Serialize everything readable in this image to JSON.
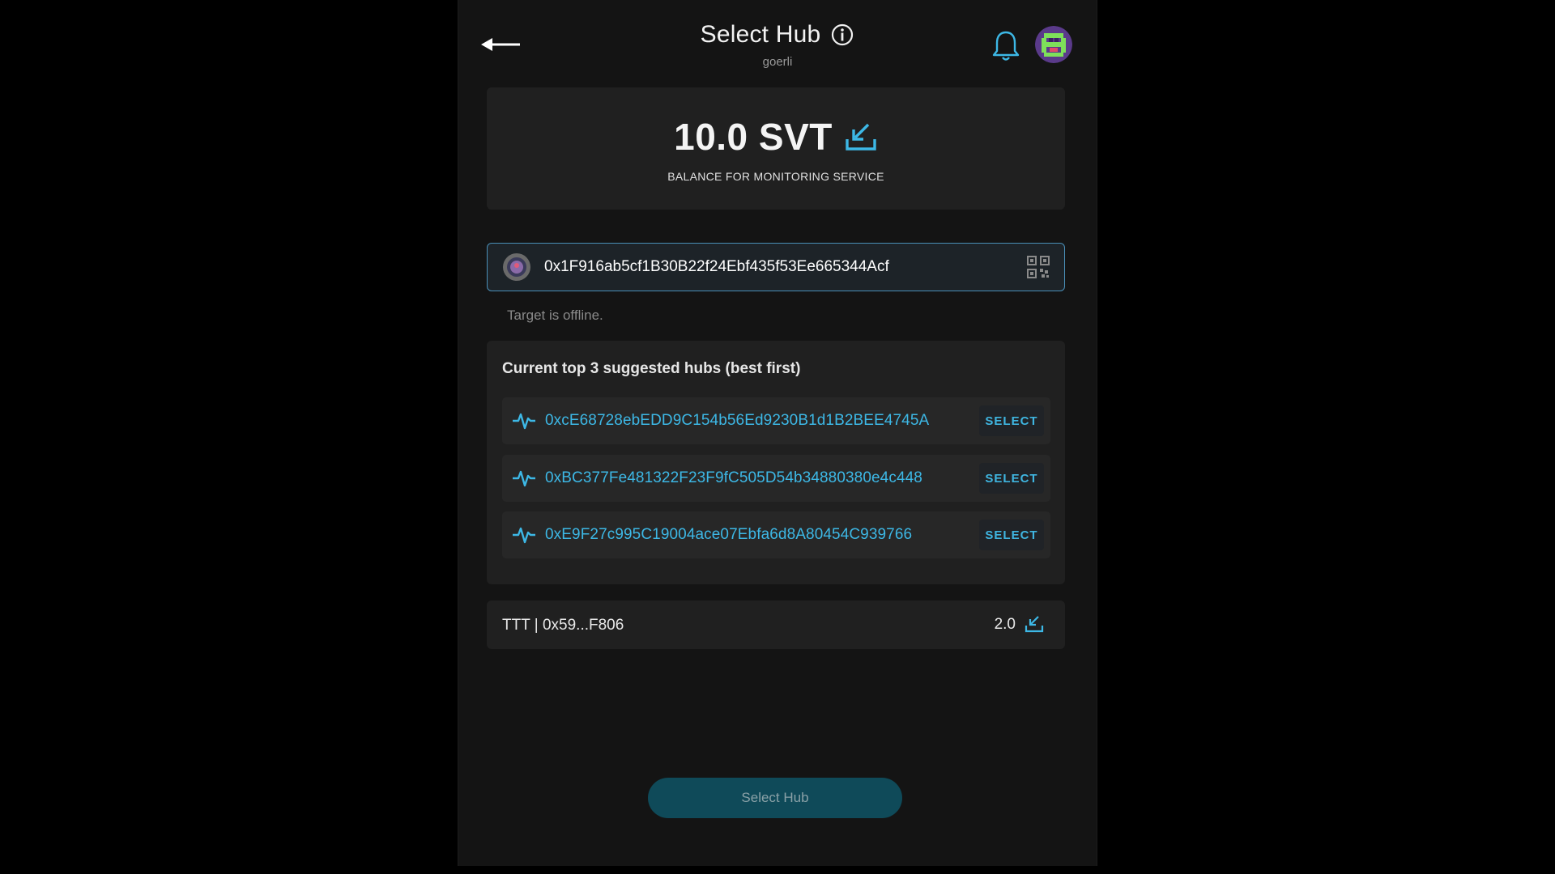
{
  "header": {
    "title": "Select Hub",
    "network": "goerli",
    "icons": {
      "back": "arrow-left-icon",
      "info": "info-icon",
      "notifications": "bell-icon",
      "avatar": "pixel-avatar"
    }
  },
  "balance": {
    "amount": "10.0 SVT",
    "caption": "BALANCE FOR MONITORING SERVICE",
    "icon": "deposit-icon"
  },
  "target": {
    "address": "0x1F916ab5cf1B30B22f24Ebf435f53Ee665344Acf",
    "status": "Target is offline.",
    "icon": "qr-code-icon"
  },
  "suggested_hubs": {
    "title": "Current top 3 suggested hubs (best first)",
    "items": [
      {
        "address": "0xcE68728ebEDD9C154b56Ed9230B1d1B2BEE4745A",
        "action": "SELECT"
      },
      {
        "address": "0xBC377Fe481322F23F9fC505D54b34880380e4c448",
        "action": "SELECT"
      },
      {
        "address": "0xE9F27c995C19004ace07Ebfa6d8A80454C939766",
        "action": "SELECT"
      }
    ]
  },
  "token": {
    "label": "TTT | 0x59...F806",
    "amount": "2.0"
  },
  "footer": {
    "button_label": "Select Hub"
  },
  "colors": {
    "accent": "#3db8e6",
    "panel": "#202020",
    "background": "#141414",
    "button": "#0f4a59"
  }
}
